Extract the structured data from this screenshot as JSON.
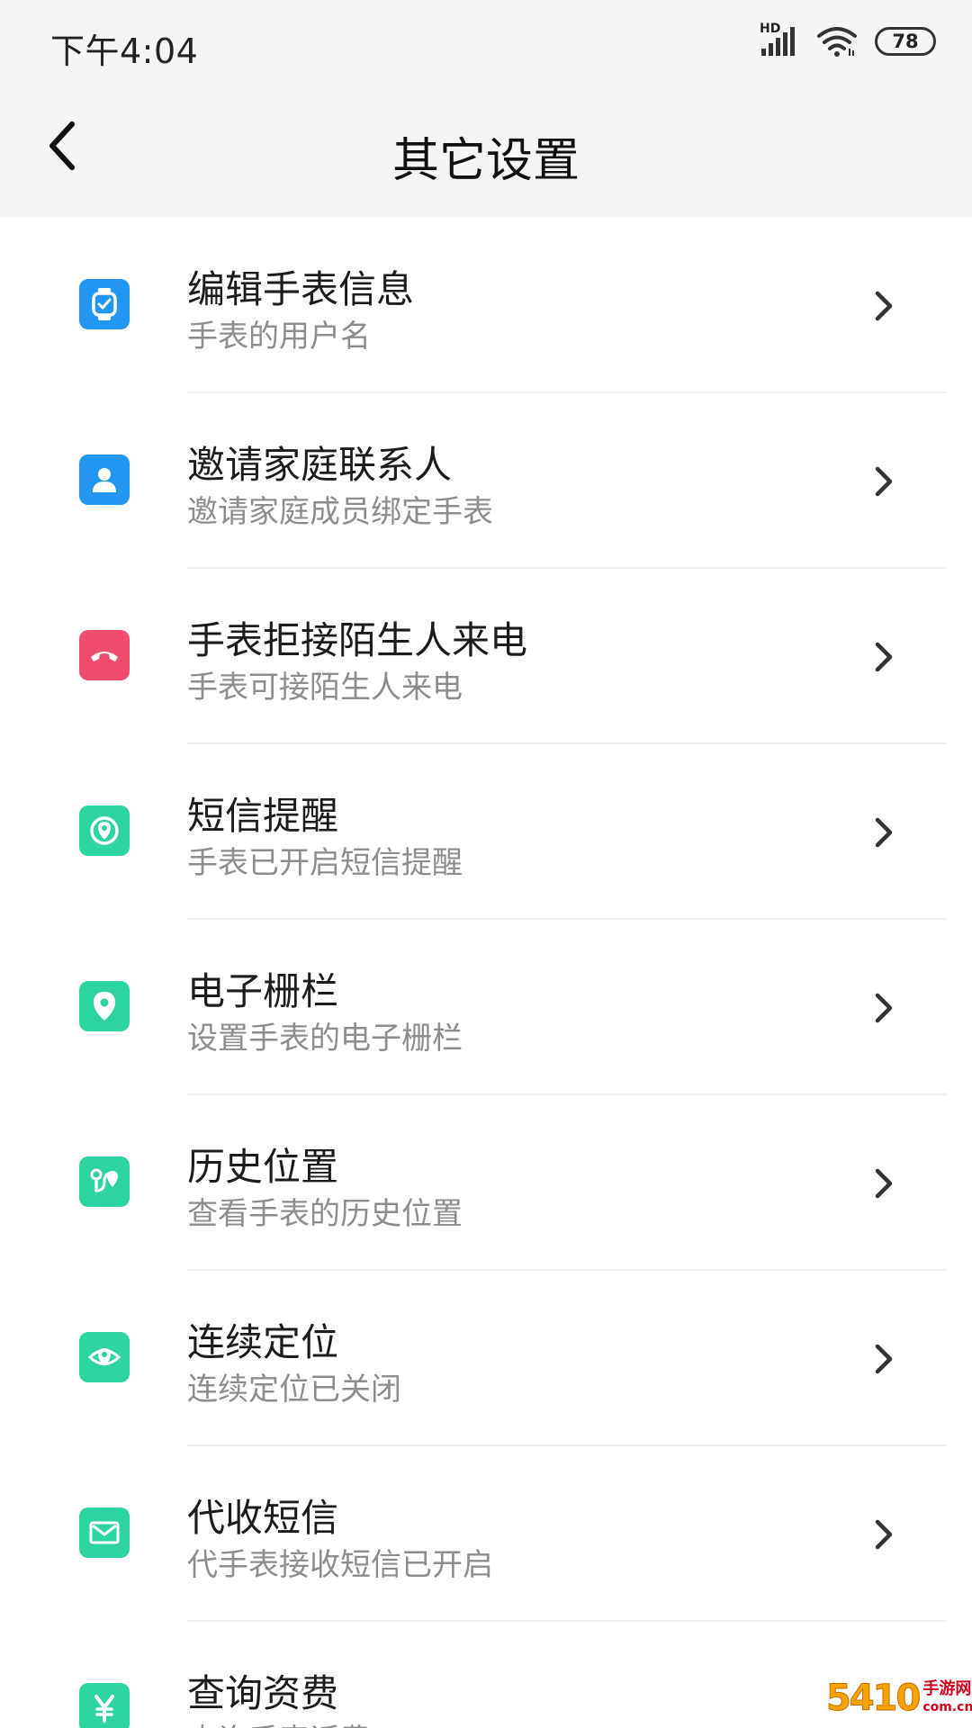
{
  "status_bar": {
    "time": "下午4:04",
    "network_label": "HD",
    "battery": "78"
  },
  "header": {
    "title": "其它设置"
  },
  "items": [
    {
      "title": "编辑手表信息",
      "subtitle": "手表的用户名",
      "icon": "watch-icon",
      "color": "#2196f3"
    },
    {
      "title": "邀请家庭联系人",
      "subtitle": "邀请家庭成员绑定手表",
      "icon": "person-icon",
      "color": "#2196f3"
    },
    {
      "title": "手表拒接陌生人来电",
      "subtitle": "手表可接陌生人来电",
      "icon": "hangup-phone-icon",
      "color": "#ee4d6d"
    },
    {
      "title": "短信提醒",
      "subtitle": "手表已开启短信提醒",
      "icon": "sms-reminder-icon",
      "color": "#2ed3a2"
    },
    {
      "title": "电子栅栏",
      "subtitle": "设置手表的电子栅栏",
      "icon": "location-pin-icon",
      "color": "#2ed3a2"
    },
    {
      "title": "历史位置",
      "subtitle": "查看手表的历史位置",
      "icon": "route-icon",
      "color": "#2ed3a2"
    },
    {
      "title": "连续定位",
      "subtitle": "连续定位已关闭",
      "icon": "continuous-location-icon",
      "color": "#2ed3a2"
    },
    {
      "title": "代收短信",
      "subtitle": "代手表接收短信已开启",
      "icon": "envelope-icon",
      "color": "#2ed3a2"
    },
    {
      "title": "查询资费",
      "subtitle": "查询手表话费",
      "icon": "yuan-icon",
      "color": "#2ed3a2"
    }
  ],
  "watermark": {
    "number": "5410",
    "text": "手游网",
    "domain": "com.cn"
  }
}
